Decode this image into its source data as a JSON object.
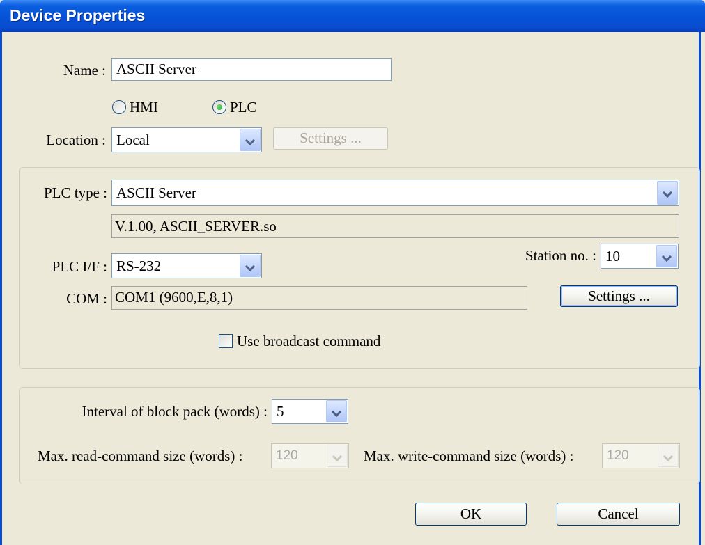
{
  "window": {
    "title": "Device Properties"
  },
  "name": {
    "label": "Name :",
    "value": "ASCII Server"
  },
  "device_role": {
    "options": [
      {
        "label": "HMI",
        "checked": false
      },
      {
        "label": "PLC",
        "checked": true
      }
    ]
  },
  "location": {
    "label": "Location :",
    "value": "Local",
    "settings_label": "Settings ..."
  },
  "plc": {
    "type_label": "PLC type :",
    "type_value": "ASCII Server",
    "version_info": "V.1.00, ASCII_SERVER.so",
    "if_label": "PLC I/F :",
    "if_value": "RS-232",
    "station_label": "Station no. :",
    "station_value": "10",
    "com_label": "COM :",
    "com_value": "COM1 (9600,E,8,1)",
    "com_settings_label": "Settings ...",
    "broadcast_label": "Use broadcast command",
    "broadcast_checked": false
  },
  "block": {
    "interval_label": "Interval of block pack (words) :",
    "interval_value": "5",
    "max_read_label": "Max. read-command size (words) :",
    "max_read_value": "120",
    "max_write_label": "Max. write-command size (words) :",
    "max_write_value": "120"
  },
  "footer": {
    "ok_label": "OK",
    "cancel_label": "Cancel"
  }
}
